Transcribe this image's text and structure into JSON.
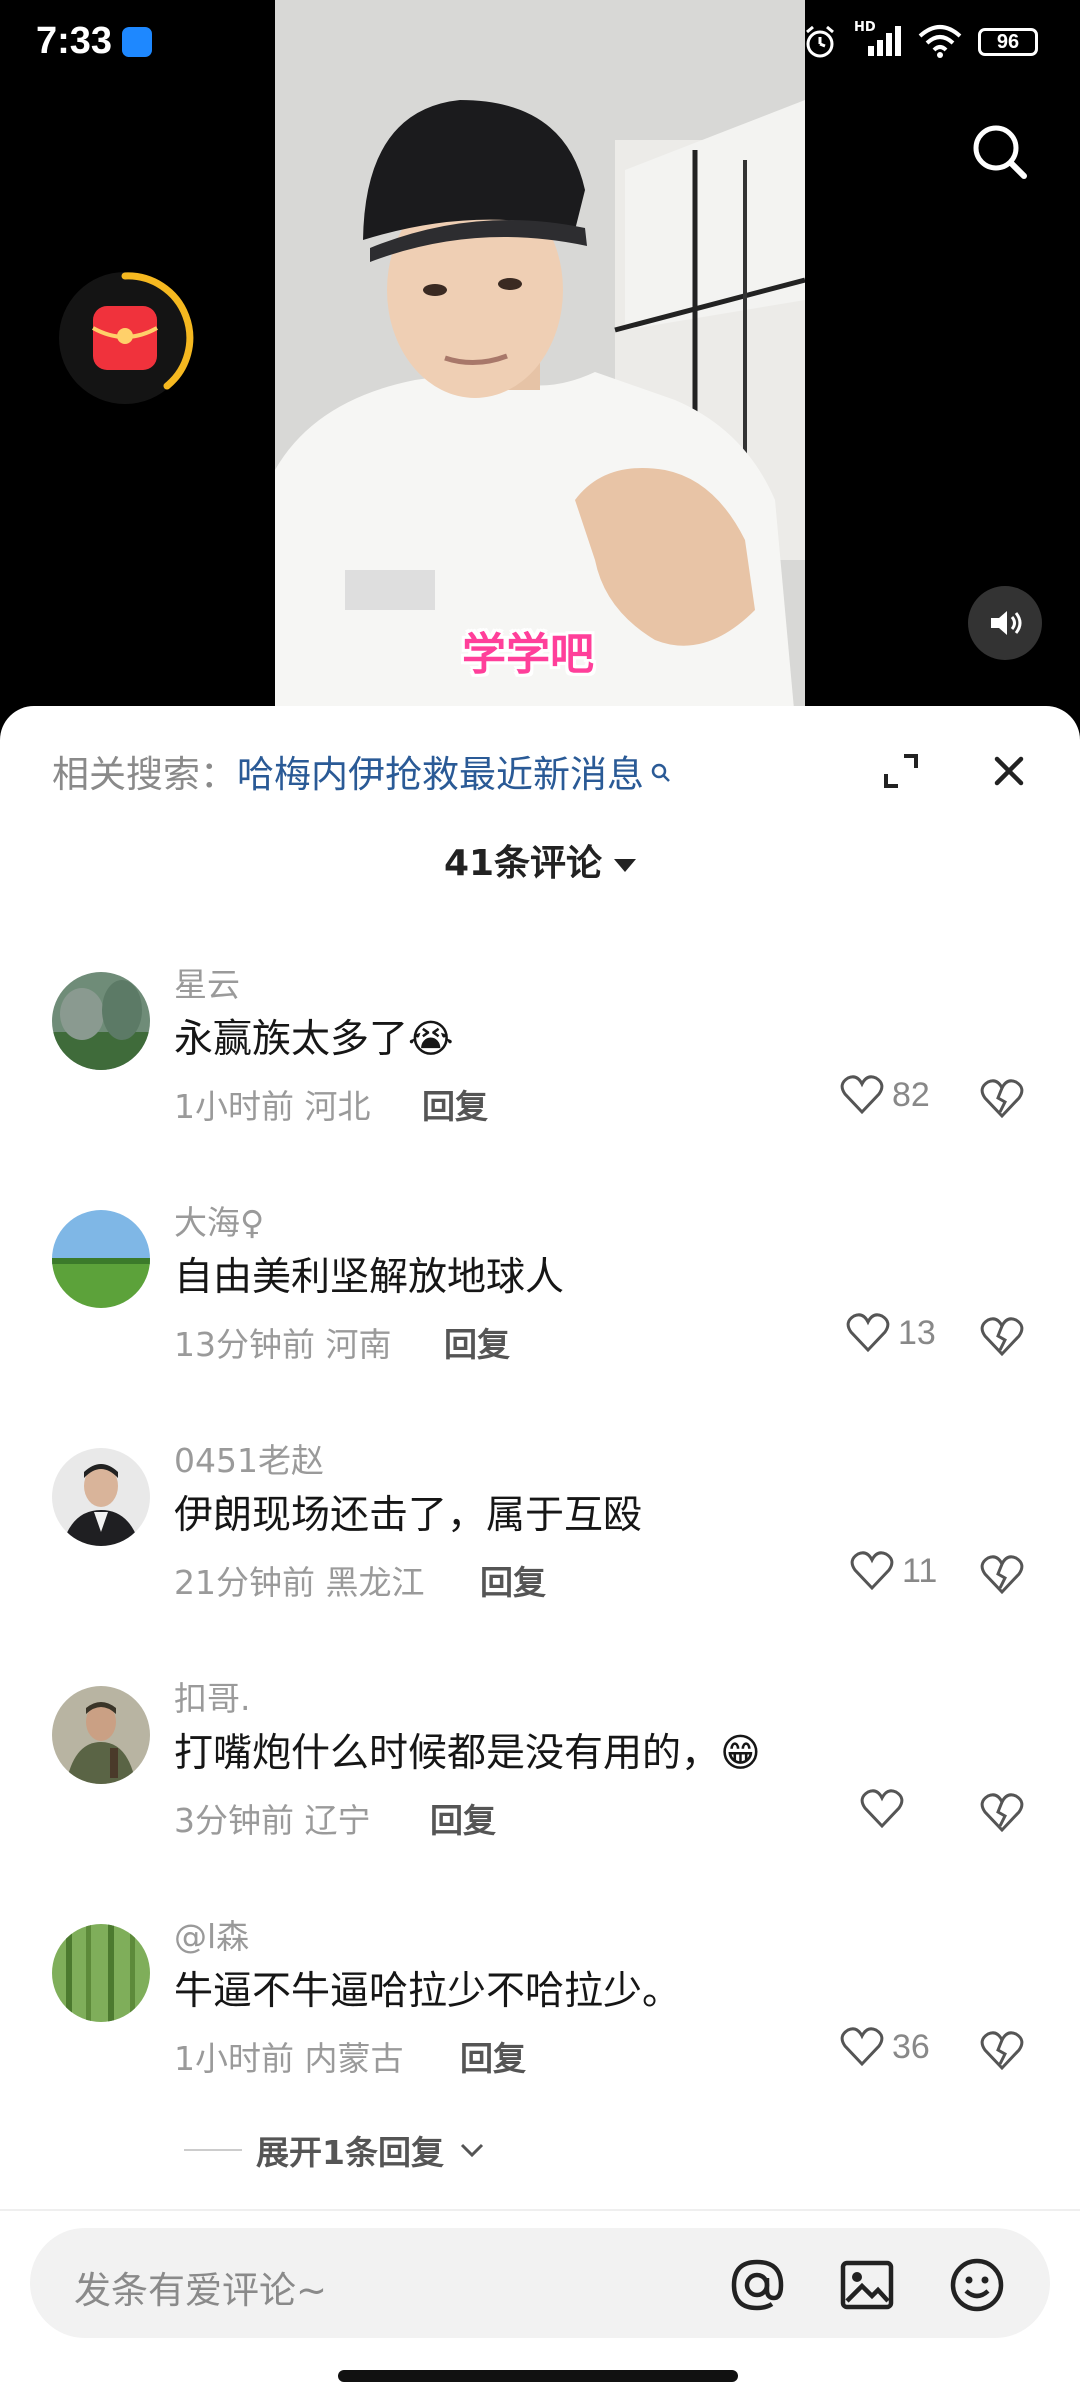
{
  "status_bar": {
    "time": "7:33",
    "battery": "96",
    "network": "HD"
  },
  "video": {
    "caption": "学学吧"
  },
  "sheet": {
    "related_label": "相关搜索：",
    "related_query": "哈梅内伊抢救最近新消息",
    "comment_count": "41条评论"
  },
  "comments": [
    {
      "user": "星云",
      "text": "永赢族太多了😭",
      "time": "1小时前",
      "region": "河北",
      "reply": "回复",
      "likes": "82"
    },
    {
      "user": "大海♀",
      "text": "自由美利坚解放地球人",
      "time": "13分钟前",
      "region": "河南",
      "reply": "回复",
      "likes": "13"
    },
    {
      "user": "0451老赵",
      "text": "伊朗现场还击了，属于互殴",
      "time": "21分钟前",
      "region": "黑龙江",
      "reply": "回复",
      "likes": "11"
    },
    {
      "user": "扣哥.",
      "text": "打嘴炮什么时候都是没有用的，😁",
      "time": "3分钟前",
      "region": "辽宁",
      "reply": "回复",
      "likes": ""
    },
    {
      "user": "@l森",
      "text": "牛逼不牛逼哈拉少不哈拉少。",
      "time": "1小时前",
      "region": "内蒙古",
      "reply": "回复",
      "likes": "36"
    }
  ],
  "more_replies": "展开1条回复",
  "input": {
    "placeholder": "发条有爱评论~"
  },
  "icons": {
    "search": "search-icon",
    "volume": "volume-icon",
    "red_packet": "red-packet-icon",
    "expand": "expand-icon",
    "close": "close-icon",
    "like": "heart-icon",
    "dislike": "broken-heart-icon",
    "mention": "at-icon",
    "image": "image-icon",
    "emoji": "emoji-icon"
  },
  "colors": {
    "link": "#2a5a96",
    "caption": "#ff3f9a",
    "red_packet": "#f0323c",
    "timer_ring": "#f5b820"
  }
}
